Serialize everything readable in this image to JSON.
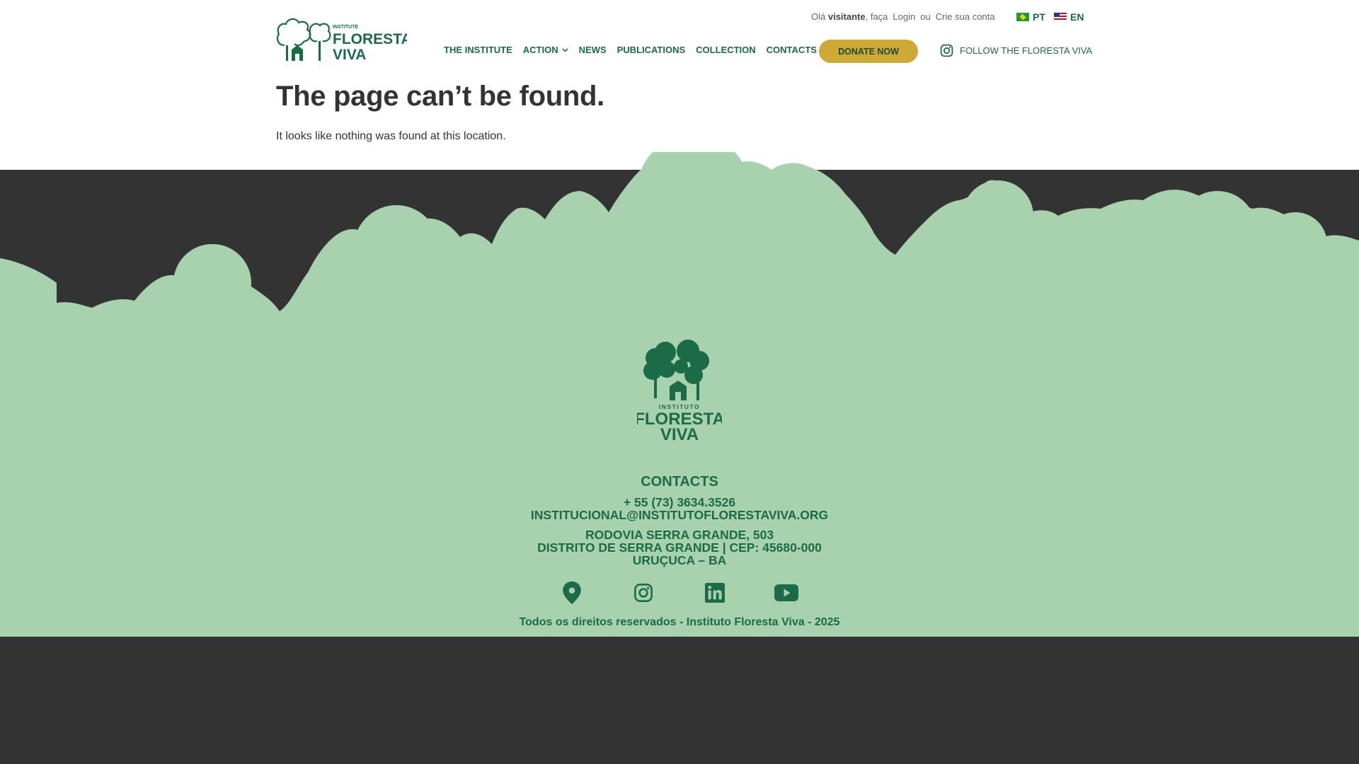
{
  "topbar": {
    "greeting_prefix": "Olá",
    "greeting_user": "visitante",
    "greeting_suffix": ", faça",
    "login": "Login",
    "or": "ou",
    "signup": "Crie sua conta"
  },
  "languages": [
    {
      "code": "PT",
      "flag": "flag-brazil-icon"
    },
    {
      "code": "EN",
      "flag": "flag-usa-icon"
    }
  ],
  "logo": {
    "small": "INSTITUTE",
    "line1": "FLORESTA",
    "line2": "VIVA"
  },
  "nav": {
    "items": [
      "THE INSTITUTE",
      "ACTION",
      "NEWS",
      "PUBLICATIONS",
      "COLLECTION",
      "CONTACTS"
    ]
  },
  "donate_label": "DONATE NOW",
  "follow_label": "FOLLOW THE FLORESTA VIVA",
  "error": {
    "title": "The page can’t be found.",
    "message": "It looks like nothing was found at this location."
  },
  "footer": {
    "logo": {
      "small": "INSTITUTO",
      "line1": "FLORESTA",
      "line2": "VIVA"
    },
    "contacts_heading": "CONTACTS",
    "phone": "+ 55 (73) 3634.3526",
    "email": "INSTITUCIONAL@INSTITUTOFLORESTAVIVA.ORG",
    "address_line1": "RODOVIA SERRA GRANDE, 503",
    "address_line2": "DISTRITO DE SERRA GRANDE | CEP: 45680-000",
    "address_line3": "URUÇUCA – BA",
    "socials": [
      "location-pin-icon",
      "instagram-icon",
      "linkedin-icon",
      "youtube-icon"
    ],
    "copyright": "Todos os direitos reservados - Instituto Floresta Viva - 2025"
  },
  "colors": {
    "brand_green": "#1b6a48",
    "footer_green": "#a8d2ad",
    "donate_gold": "#cfa935",
    "bottom_dark": "#333333"
  }
}
